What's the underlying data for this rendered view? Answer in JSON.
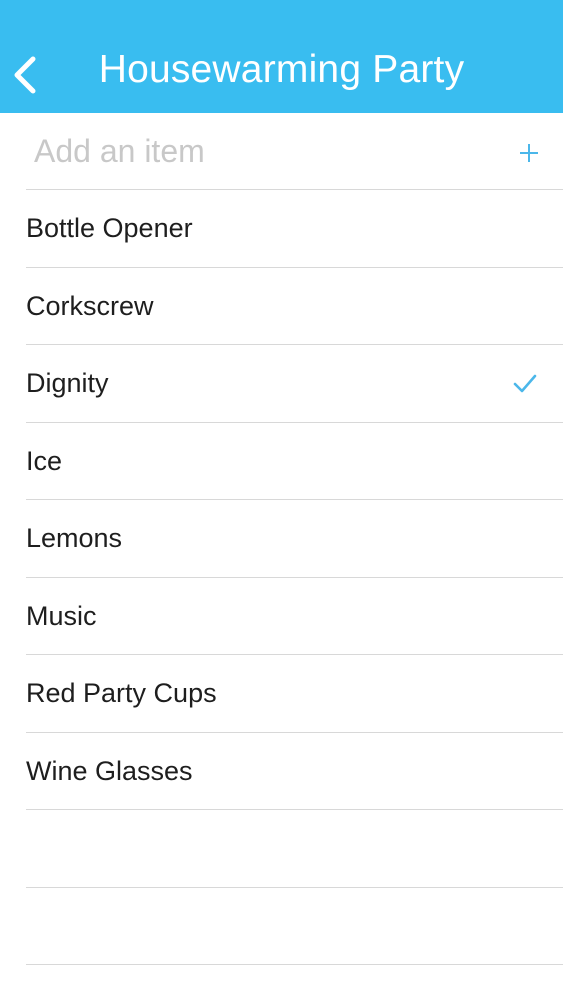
{
  "header": {
    "title": "Housewarming Party",
    "background_color": "#39bdf0",
    "back_icon": "chevron-left-icon"
  },
  "add_item": {
    "placeholder": "Add an item",
    "value": "",
    "add_icon": "plus-icon"
  },
  "items": [
    {
      "label": "Bottle Opener",
      "checked": false
    },
    {
      "label": "Corkscrew",
      "checked": false
    },
    {
      "label": "Dignity",
      "checked": true
    },
    {
      "label": "Ice",
      "checked": false
    },
    {
      "label": "Lemons",
      "checked": false
    },
    {
      "label": "Music",
      "checked": false
    },
    {
      "label": "Red Party Cups",
      "checked": false
    },
    {
      "label": "Wine Glasses",
      "checked": false
    }
  ],
  "accent_color": "#4bb7ea",
  "check_icon": "checkmark-icon"
}
